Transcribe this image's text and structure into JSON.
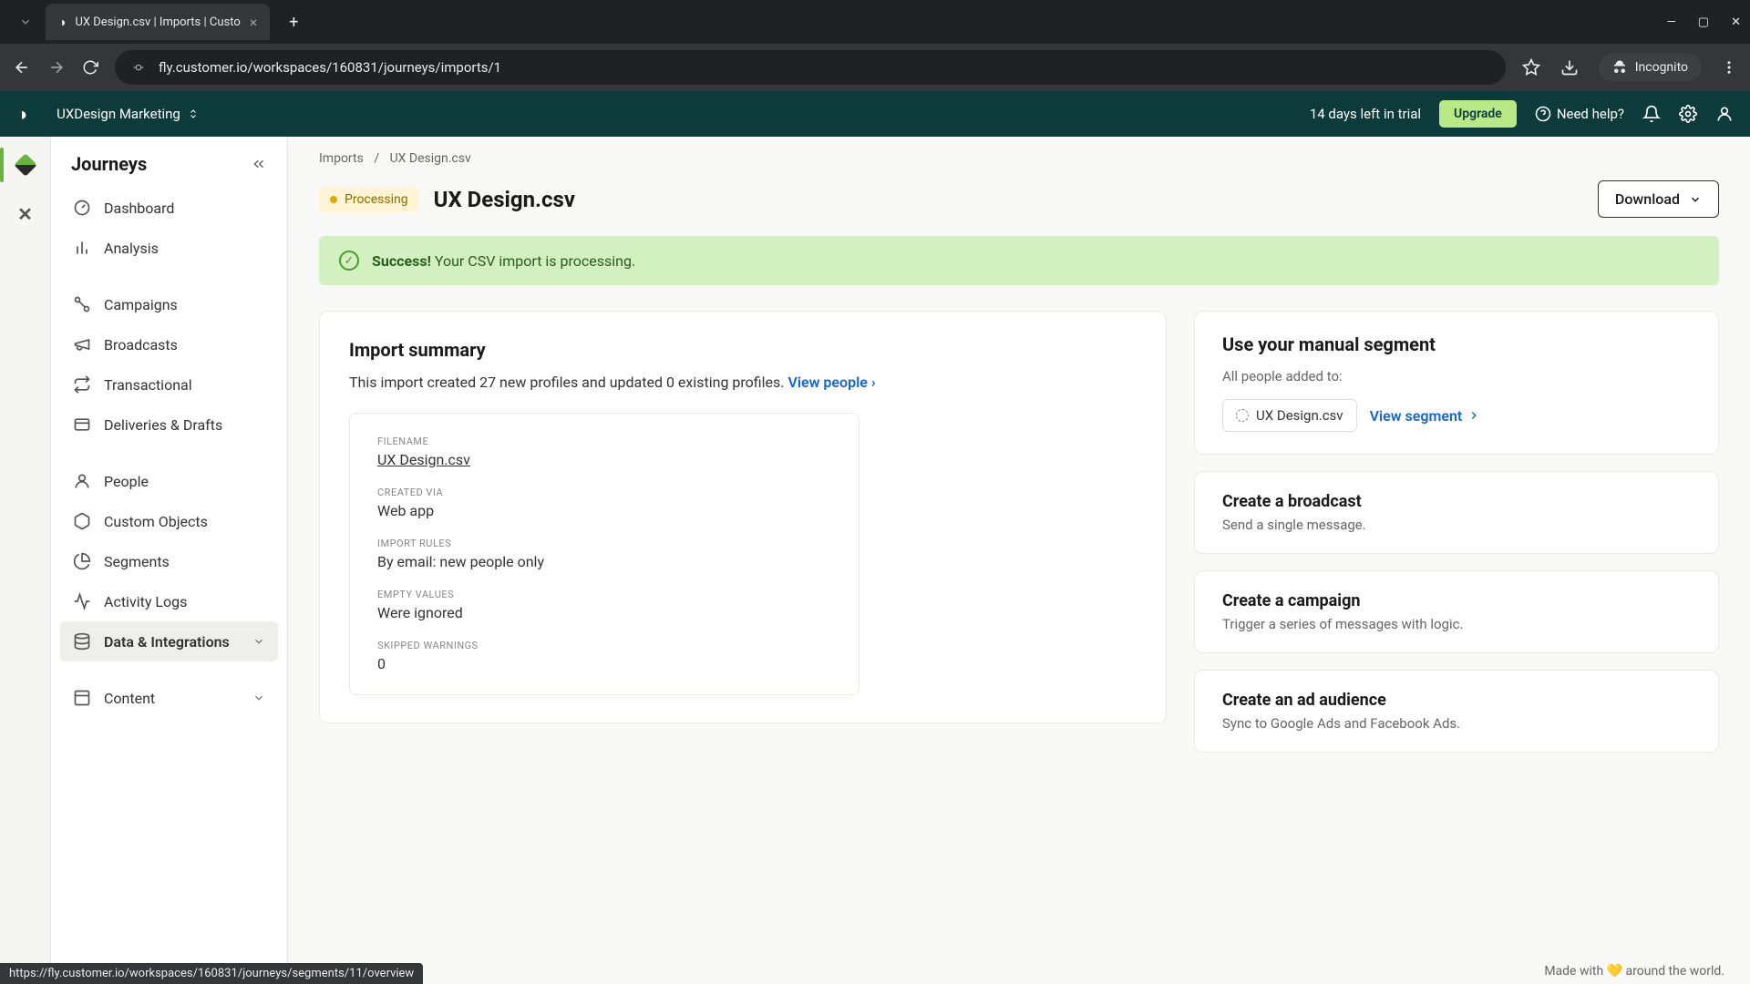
{
  "browser": {
    "tab_title": "UX Design.csv | Imports | Custo",
    "url": "fly.customer.io/workspaces/160831/journeys/imports/1",
    "incognito_label": "Incognito",
    "status_url": "https://fly.customer.io/workspaces/160831/journeys/segments/11/overview"
  },
  "header": {
    "workspace": "UXDesign Marketing",
    "trial_text": "14 days left in trial",
    "upgrade": "Upgrade",
    "help": "Need help?"
  },
  "sidebar": {
    "title": "Journeys",
    "items": [
      {
        "label": "Dashboard"
      },
      {
        "label": "Analysis"
      },
      {
        "label": "Campaigns"
      },
      {
        "label": "Broadcasts"
      },
      {
        "label": "Transactional"
      },
      {
        "label": "Deliveries & Drafts"
      },
      {
        "label": "People"
      },
      {
        "label": "Custom Objects"
      },
      {
        "label": "Segments"
      },
      {
        "label": "Activity Logs"
      },
      {
        "label": "Data & Integrations"
      },
      {
        "label": "Content"
      }
    ]
  },
  "breadcrumb": {
    "parent": "Imports",
    "current": "UX Design.csv"
  },
  "page": {
    "status": "Processing",
    "title": "UX Design.csv",
    "download": "Download"
  },
  "banner": {
    "strong": "Success!",
    "text": "Your CSV import is processing."
  },
  "summary": {
    "title": "Import summary",
    "text": "This import created 27 new profiles and updated 0 existing profiles.",
    "view_people": "View people",
    "meta": {
      "filename_label": "FILENAME",
      "filename": "UX Design.csv",
      "created_via_label": "CREATED VIA",
      "created_via": "Web app",
      "rules_label": "IMPORT RULES",
      "rules": "By email: new people only",
      "empty_label": "EMPTY VALUES",
      "empty": "Were ignored",
      "skipped_label": "SKIPPED WARNINGS",
      "skipped": "0"
    }
  },
  "segment_card": {
    "title": "Use your manual segment",
    "subtitle": "All people added to:",
    "chip": "UX Design.csv",
    "view_link": "View segment"
  },
  "actions": [
    {
      "title": "Create a broadcast",
      "desc": "Send a single message."
    },
    {
      "title": "Create a campaign",
      "desc": "Trigger a series of messages with logic."
    },
    {
      "title": "Create an ad audience",
      "desc": "Sync to Google Ads and Facebook Ads."
    }
  ],
  "footer": "Made with 💛 around the world."
}
